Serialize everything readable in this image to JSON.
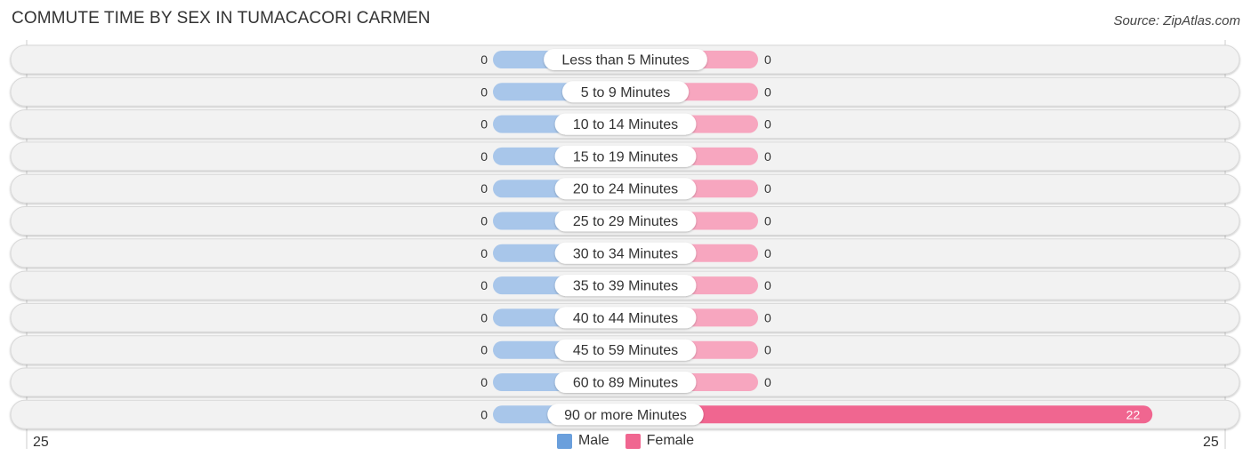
{
  "header": {
    "title": "COMMUTE TIME BY SEX IN TUMACACORI CARMEN",
    "source": "Source: ZipAtlas.com"
  },
  "legend": {
    "items": [
      {
        "name": "Male",
        "color": "#6a9fdc"
      },
      {
        "name": "Female",
        "color": "#f06690"
      }
    ]
  },
  "axis": {
    "left_label": "25",
    "right_label": "25"
  },
  "colors": {
    "male_bar": "#a8c6ea",
    "female_bar_light": "#f7a6bf",
    "female_bar_strong": "#f06690",
    "row_bg": "#f2f2f2",
    "row_border": "#d8d8d8"
  },
  "chart_data": {
    "type": "bar",
    "orientation": "horizontal-diverging",
    "title": "COMMUTE TIME BY SEX IN TUMACACORI CARMEN",
    "xlabel": "",
    "ylabel": "",
    "xlim": [
      -25,
      25
    ],
    "x_tick_labels": [
      "25",
      "25"
    ],
    "legend_position": "bottom-center",
    "grid": false,
    "categories": [
      "Less than 5 Minutes",
      "5 to 9 Minutes",
      "10 to 14 Minutes",
      "15 to 19 Minutes",
      "20 to 24 Minutes",
      "25 to 29 Minutes",
      "30 to 34 Minutes",
      "35 to 39 Minutes",
      "40 to 44 Minutes",
      "45 to 59 Minutes",
      "60 to 89 Minutes",
      "90 or more Minutes"
    ],
    "series": [
      {
        "name": "Male",
        "values": [
          0,
          0,
          0,
          0,
          0,
          0,
          0,
          0,
          0,
          0,
          0,
          0
        ]
      },
      {
        "name": "Female",
        "values": [
          0,
          0,
          0,
          0,
          0,
          0,
          0,
          0,
          0,
          0,
          0,
          22
        ]
      }
    ]
  }
}
